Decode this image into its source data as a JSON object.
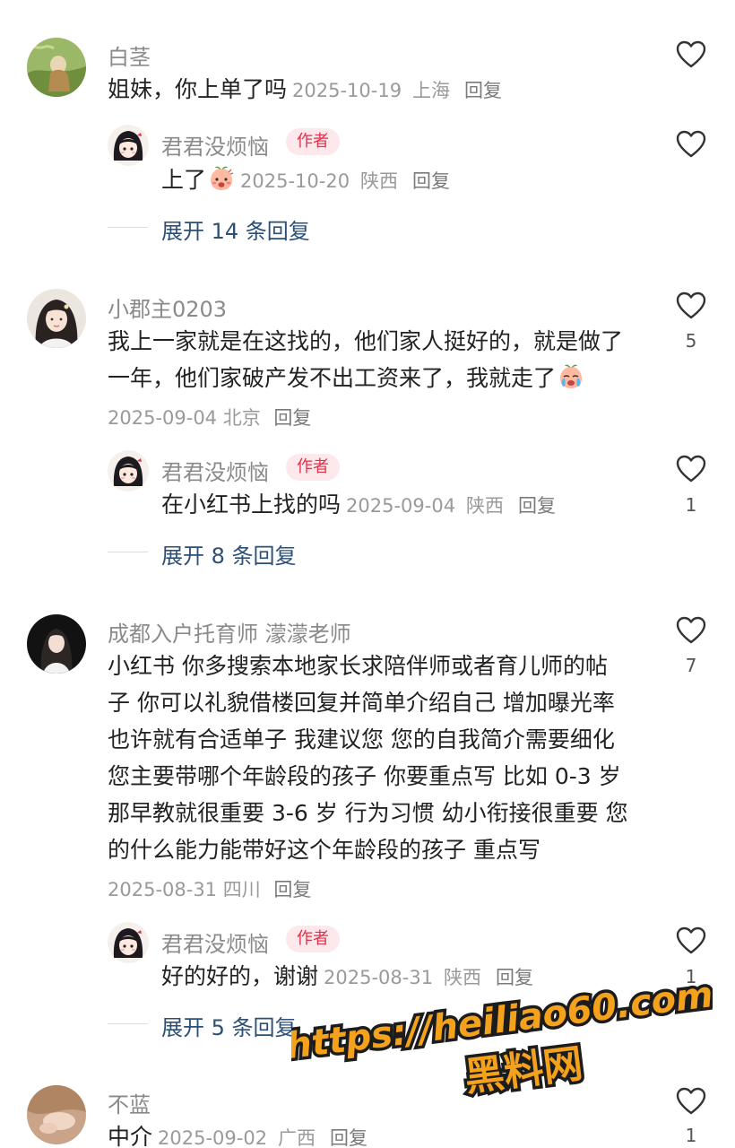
{
  "colors": {
    "author_badge_bg": "#fde8ec",
    "author_badge_text": "#e0314b",
    "expand_link": "#2c4f76",
    "meta": "#9a9a9a",
    "watermark": "#f4a11c"
  },
  "comments": [
    {
      "username": "白茎",
      "text_lines": [
        "姐妹，你上单了吗"
      ],
      "date": "2025-10-19",
      "location": "上海",
      "reply_label": "回复",
      "likes": "",
      "reply": {
        "username": "君君没烦恼",
        "badge": "作者",
        "text": "上了",
        "emoji": "shy-peach-emoji",
        "date": "2025-10-20",
        "location": "陕西",
        "reply_label": "回复",
        "likes": ""
      },
      "expand_label": "展开 14 条回复"
    },
    {
      "username": "小郡主0203",
      "text_lines": [
        "我上一家就是在这找的，他们家人挺好的，就是做了",
        "一年，他们家破产发不出工资来了，我就走了"
      ],
      "emoji": "crying-emoji",
      "date": "2025-09-04",
      "location": "北京",
      "reply_label": "回复",
      "likes": "5",
      "reply": {
        "username": "君君没烦恼",
        "badge": "作者",
        "text": "在小红书上找的吗",
        "date": "2025-09-04",
        "location": "陕西",
        "reply_label": "回复",
        "likes": "1"
      },
      "expand_label": "展开 8 条回复"
    },
    {
      "username": "成都入户托育师 濛濛老师",
      "text_lines": [
        "小红书 你多搜索本地家长求陪伴师或者育儿师的帖",
        "子 你可以礼貌借楼回复并简单介绍自己 增加曝光率",
        "也许就有合适单子 我建议您 您的自我简介需要细化",
        "您主要带哪个年龄段的孩子 你要重点写 比如 0-3 岁",
        "那早教就很重要 3-6 岁 行为习惯 幼小衔接很重要 您",
        "的什么能力能带好这个年龄段的孩子 重点写"
      ],
      "date": "2025-08-31",
      "location": "四川",
      "reply_label": "回复",
      "likes": "7",
      "reply": {
        "username": "君君没烦恼",
        "badge": "作者",
        "text": "好的好的，谢谢",
        "date": "2025-08-31",
        "location": "陕西",
        "reply_label": "回复",
        "likes": "1"
      },
      "expand_label": "展开 5 条回复"
    },
    {
      "username": "不蓝",
      "text_lines": [
        "中介"
      ],
      "date": "2025-09-02",
      "location": "广西",
      "reply_label": "回复",
      "likes": "1"
    }
  ],
  "watermark": {
    "url": "https://heiliao60.com",
    "label": "黑料网"
  }
}
